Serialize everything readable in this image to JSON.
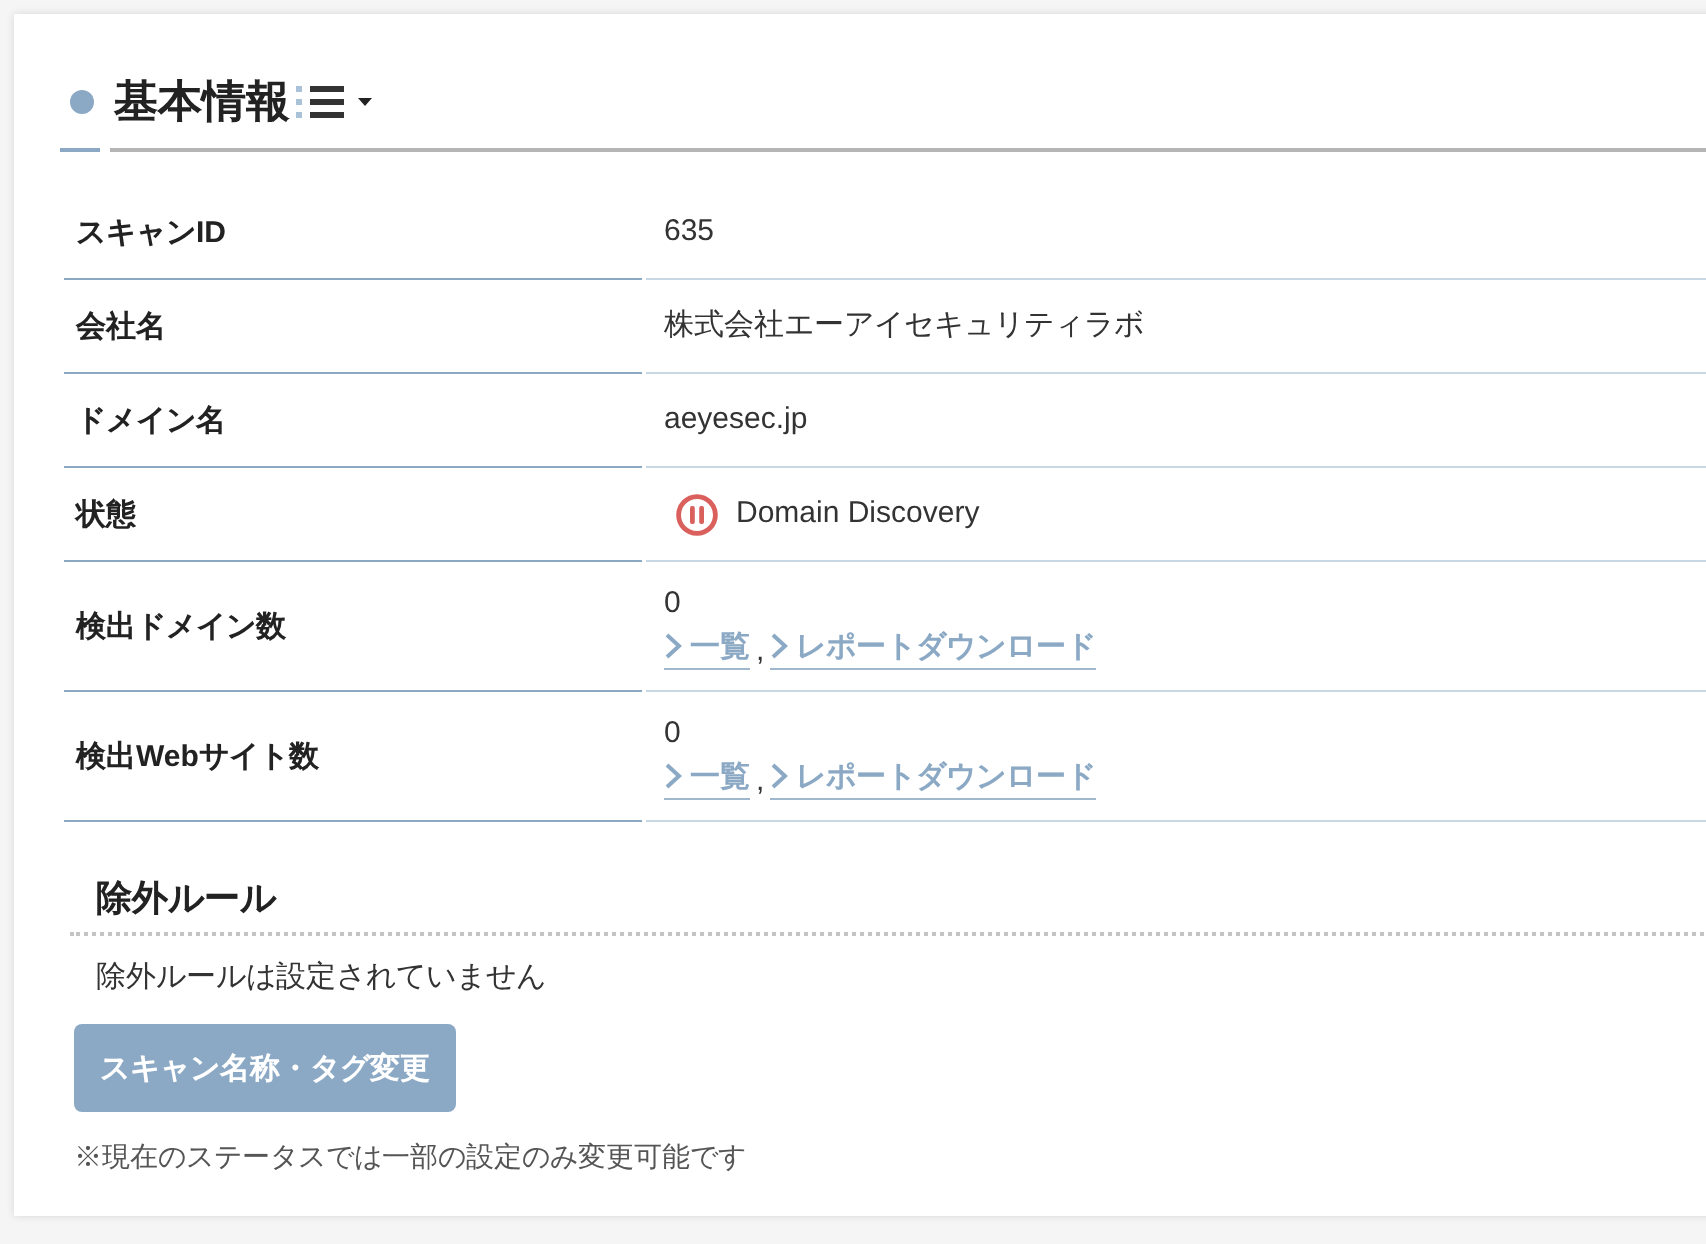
{
  "section": {
    "title": "基本情報"
  },
  "fields": [
    {
      "kind": "text",
      "label": "スキャンID",
      "value": "635"
    },
    {
      "kind": "text",
      "label": "会社名",
      "value": "株式会社エーアイセキュリティラボ"
    },
    {
      "kind": "text",
      "label": "ドメイン名",
      "value": "aeyesec.jp"
    },
    {
      "kind": "status",
      "label": "状態",
      "value": "Domain Discovery",
      "paused": true
    },
    {
      "kind": "count",
      "label": "検出ドメイン数",
      "value": "0",
      "links": [
        "一覧",
        "レポートダウンロード"
      ],
      "separator": ","
    },
    {
      "kind": "count",
      "label": "検出Webサイト数",
      "value": "0",
      "links": [
        "一覧",
        "レポートダウンロード"
      ],
      "separator": ","
    }
  ],
  "exclusion_rules": {
    "title": "除外ルール",
    "message": "除外ルールは設定されていません"
  },
  "edit_button": {
    "label": "スキャン名称・タグ変更"
  },
  "note": "※現在のステータスでは一部の設定のみ変更可能です"
}
